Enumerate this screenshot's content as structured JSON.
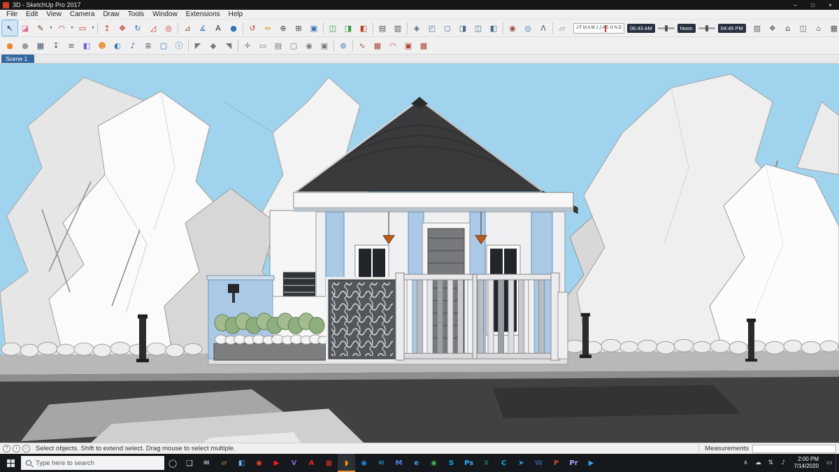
{
  "colors": {
    "titlebar": "#161616",
    "taskbar": "#15181c",
    "scene_tab": "#34689f",
    "selection_blue": "#cfe6f8",
    "sky": "#9fd3ee",
    "accent": "#a9c9e7",
    "roof": "#3a3a3d",
    "road": "#414144",
    "sidewalk": "#b8b8b9"
  },
  "window": {
    "title": "3D - SketchUp Pro 2017",
    "minimize": "–",
    "maximize": "□",
    "close": "×"
  },
  "menu": {
    "items": [
      {
        "name": "menu-file",
        "label": "File"
      },
      {
        "name": "menu-edit",
        "label": "Edit"
      },
      {
        "name": "menu-view",
        "label": "View"
      },
      {
        "name": "menu-camera",
        "label": "Camera"
      },
      {
        "name": "menu-draw",
        "label": "Draw"
      },
      {
        "name": "menu-tools",
        "label": "Tools"
      },
      {
        "name": "menu-window",
        "label": "Window"
      },
      {
        "name": "menu-extensions",
        "label": "Extensions"
      },
      {
        "name": "menu-help",
        "label": "Help"
      }
    ]
  },
  "toolbar_row1": {
    "tools_a": [
      {
        "name": "select-tool-icon",
        "glyph": "↖",
        "color": "#1c1c1c",
        "state": "pressed"
      },
      {
        "name": "eraser-tool-icon",
        "glyph": "◪",
        "color": "#d87093"
      },
      {
        "name": "line-tool-icon",
        "glyph": "✎",
        "color": "#6b4a2b"
      },
      {
        "name": "line-flyout-icon",
        "glyph": "▾",
        "type": "dd"
      },
      {
        "name": "arc-tool-icon",
        "glyph": "◠",
        "color": "#c13b2a"
      },
      {
        "name": "arc-flyout-icon",
        "glyph": "▾",
        "type": "dd"
      },
      {
        "name": "rectangle-tool-icon",
        "glyph": "▭",
        "color": "#c13b2a"
      },
      {
        "name": "shapes-flyout-icon",
        "glyph": "▾",
        "type": "dd"
      },
      {
        "type": "sep",
        "name": "toolbar-separator"
      },
      {
        "name": "push-pull-tool-icon",
        "glyph": "↥",
        "color": "#c13b2a"
      },
      {
        "name": "move-tool-icon",
        "glyph": "✥",
        "color": "#c13b2a"
      },
      {
        "name": "rotate-tool-icon",
        "glyph": "↻",
        "color": "#2e74b5"
      },
      {
        "name": "scale-tool-icon",
        "glyph": "◿",
        "color": "#c13b2a"
      },
      {
        "name": "offset-tool-icon",
        "glyph": "◎",
        "color": "#c13b2a"
      },
      {
        "type": "sep",
        "name": "toolbar-separator"
      },
      {
        "name": "tape-measure-tool-icon",
        "glyph": "⊿",
        "color": "#8a5a2a"
      },
      {
        "name": "protractor-tool-icon",
        "glyph": "∡",
        "color": "#2e74b5"
      },
      {
        "name": "text-tool-icon",
        "glyph": "A",
        "color": "#333333"
      },
      {
        "name": "paint-bucket-tool-icon",
        "glyph": "●",
        "color": "#2e74b5"
      },
      {
        "type": "sep",
        "name": "toolbar-separator"
      },
      {
        "name": "orbit-tool-icon",
        "glyph": "↺",
        "color": "#c13b2a"
      },
      {
        "name": "pan-tool-icon",
        "glyph": "⇔",
        "color": "#d4a017"
      },
      {
        "name": "zoom-tool-icon",
        "glyph": "⊕",
        "color": "#444444"
      },
      {
        "name": "zoom-window-icon",
        "glyph": "⊞",
        "color": "#444444"
      },
      {
        "name": "zoom-extents-icon",
        "glyph": "▣",
        "color": "#2e74b5"
      },
      {
        "type": "sep",
        "name": "toolbar-separator"
      },
      {
        "name": "section-plane-icon",
        "glyph": "◫",
        "color": "#3a9a4a"
      },
      {
        "name": "section-display-icon",
        "glyph": "◨",
        "color": "#3a9a4a"
      },
      {
        "name": "section-cut-icon",
        "glyph": "◧",
        "color": "#c13b2a"
      },
      {
        "type": "sep",
        "name": "toolbar-separator"
      },
      {
        "name": "hide-rest-of-model-icon",
        "glyph": "▤",
        "color": "#555555"
      },
      {
        "name": "back-edges-icon",
        "glyph": "▥",
        "color": "#555555"
      },
      {
        "type": "sep",
        "name": "toolbar-separator"
      },
      {
        "name": "iso-view-icon",
        "glyph": "◈",
        "color": "#4a6f8f"
      },
      {
        "name": "top-view-icon",
        "glyph": "◰",
        "color": "#4a6f8f"
      },
      {
        "name": "front-view-icon",
        "glyph": "◻",
        "color": "#4a6f8f"
      },
      {
        "name": "right-view-icon",
        "glyph": "◨",
        "color": "#4a6f8f"
      },
      {
        "name": "back-view-icon",
        "glyph": "◫",
        "color": "#4a6f8f"
      },
      {
        "name": "left-view-icon",
        "glyph": "◧",
        "color": "#4a6f8f"
      },
      {
        "type": "sep",
        "name": "toolbar-separator"
      },
      {
        "name": "position-camera-icon",
        "glyph": "◉",
        "color": "#a04a4a"
      },
      {
        "name": "look-around-icon",
        "glyph": "◎",
        "color": "#2e74b5"
      },
      {
        "name": "walk-tool-icon",
        "glyph": "Λ",
        "color": "#555555"
      },
      {
        "type": "sep",
        "name": "toolbar-separator"
      },
      {
        "name": "large-eraser-icon",
        "glyph": "▱",
        "color": "#888888"
      }
    ],
    "shadow": {
      "months": "J F M A M J J A S O N D",
      "start": "06:43 AM",
      "mid": "Noon",
      "end": "04:45 PM"
    },
    "tools_b": [
      {
        "name": "materials-panel-icon",
        "glyph": "▨",
        "color": "#666666"
      },
      {
        "name": "components-panel-icon",
        "glyph": "❖",
        "color": "#666666"
      },
      {
        "name": "warehouse-home-icon",
        "glyph": "⌂",
        "color": "#444444"
      },
      {
        "name": "model-box-icon",
        "glyph": "◫",
        "color": "#666666"
      },
      {
        "name": "architecture-icon",
        "glyph": "⌂",
        "color": "#888888"
      },
      {
        "name": "print-icon",
        "glyph": "▦",
        "color": "#555555"
      }
    ]
  },
  "toolbar_row2": {
    "tools": [
      {
        "name": "paint-material-icon",
        "glyph": "●",
        "color": "#e8882a"
      },
      {
        "name": "styles-sphere-icon",
        "glyph": "●",
        "color": "#9a9a9a"
      },
      {
        "name": "printer-icon",
        "glyph": "▦",
        "color": "#44556a"
      },
      {
        "name": "export-icon",
        "glyph": "↧",
        "color": "#555555"
      },
      {
        "name": "layers-stack-icon",
        "glyph": "≡",
        "color": "#555555"
      },
      {
        "name": "component-box-icon",
        "glyph": "◧",
        "color": "#7b5cd6"
      },
      {
        "name": "face-style-icon",
        "glyph": "☻",
        "color": "#e8882a"
      },
      {
        "name": "globe-model-icon",
        "glyph": "◐",
        "color": "#2e74b5"
      },
      {
        "name": "sound-icon",
        "glyph": "♪",
        "color": "#3a6ea5"
      },
      {
        "name": "sliders-icon",
        "glyph": "≣",
        "color": "#555555"
      },
      {
        "name": "chat-bubble-icon",
        "glyph": "▢",
        "color": "#2e74b5"
      },
      {
        "name": "info-circle-icon",
        "glyph": "ⓘ",
        "color": "#2e74b5"
      },
      {
        "type": "sep",
        "name": "toolbar-separator"
      },
      {
        "name": "align-left-icon",
        "glyph": "◤",
        "color": "#777777"
      },
      {
        "name": "align-center-icon",
        "glyph": "◆",
        "color": "#777777"
      },
      {
        "name": "align-right-icon",
        "glyph": "◥",
        "color": "#777777"
      },
      {
        "type": "sep",
        "name": "toolbar-separator"
      },
      {
        "name": "interact-tool-icon",
        "glyph": "✛",
        "color": "#777777"
      },
      {
        "name": "component-options-icon",
        "glyph": "▭",
        "color": "#777777"
      },
      {
        "name": "component-attributes-icon",
        "glyph": "▤",
        "color": "#777777"
      },
      {
        "name": "camera-create-icon",
        "glyph": "▢",
        "color": "#777777"
      },
      {
        "name": "camera-look-icon",
        "glyph": "◉",
        "color": "#777777"
      },
      {
        "name": "camera-settings-icon",
        "glyph": "▣",
        "color": "#777777"
      },
      {
        "type": "sep",
        "name": "toolbar-separator"
      },
      {
        "name": "add-location-globe-icon",
        "glyph": "⊚",
        "color": "#2e74b5"
      },
      {
        "type": "sep",
        "name": "toolbar-separator"
      },
      {
        "name": "sandbox-from-contours-icon",
        "glyph": "∿",
        "color": "#a84432"
      },
      {
        "name": "sandbox-from-scratch-icon",
        "glyph": "▦",
        "color": "#a84432"
      },
      {
        "name": "smoove-tool-icon",
        "glyph": "◠",
        "color": "#a84432"
      },
      {
        "name": "stamp-tool-icon",
        "glyph": "▣",
        "color": "#a84432"
      },
      {
        "name": "drape-tool-icon",
        "glyph": "▩",
        "color": "#a84432"
      }
    ]
  },
  "scene_tabs": {
    "active": "Scene 1"
  },
  "statusbar": {
    "icons": [
      {
        "name": "geolocation-status-icon",
        "glyph": "?"
      },
      {
        "name": "credits-status-icon",
        "glyph": "i"
      },
      {
        "name": "help-status-icon",
        "glyph": "☺"
      }
    ],
    "hint": "Select objects. Shift to extend select. Drag mouse to select multiple.",
    "measurements_label": "Measurements",
    "measurements_value": ""
  },
  "taskbar": {
    "search": {
      "placeholder": "Type here to search"
    },
    "cortana_glyph": "◯",
    "taskview_glyph": "❏",
    "apps": [
      {
        "name": "mail-icon",
        "glyph": "✉",
        "color": "#e3e6ea"
      },
      {
        "name": "file-explorer-icon",
        "glyph": "▱",
        "color": "#f6c65a"
      },
      {
        "name": "photos-icon",
        "glyph": "◧",
        "color": "#64b5f6"
      },
      {
        "name": "opera-icon",
        "glyph": "◉",
        "color": "#ea4335"
      },
      {
        "name": "youtube-icon",
        "glyph": "▶",
        "color": "#ff1a1a"
      },
      {
        "name": "viber-icon",
        "glyph": "V",
        "color": "#8e61d6"
      },
      {
        "name": "adobe-reader-icon",
        "glyph": "A",
        "color": "#e2231a"
      },
      {
        "name": "red-tiles-app-icon",
        "glyph": "▦",
        "color": "#d93025"
      },
      {
        "name": "firefox-icon",
        "glyph": "◗",
        "color": "#ff9400",
        "active": true
      },
      {
        "name": "compass-browser-icon",
        "glyph": "◉",
        "color": "#1b88e5"
      },
      {
        "name": "thunderbird-icon",
        "glyph": "✉",
        "color": "#2aa1da"
      },
      {
        "name": "gmail-icon",
        "glyph": "M",
        "color": "#5086ec"
      },
      {
        "name": "edge-icon",
        "glyph": "e",
        "color": "#35a2e5"
      },
      {
        "name": "chrome-icon",
        "glyph": "◉",
        "color": "#4caf50"
      },
      {
        "name": "skype-icon",
        "glyph": "S",
        "color": "#00aff0"
      },
      {
        "name": "photoshop-icon",
        "glyph": "Ps",
        "color": "#31a8ff"
      },
      {
        "name": "excel-icon",
        "glyph": "X",
        "color": "#1d6f42"
      },
      {
        "name": "teal-c-app-icon",
        "glyph": "C",
        "color": "#00bcd4"
      },
      {
        "name": "telegram-icon",
        "glyph": "➤",
        "color": "#2aa3da"
      },
      {
        "name": "word-icon",
        "glyph": "W",
        "color": "#2b579a"
      },
      {
        "name": "powerpoint-icon",
        "glyph": "P",
        "color": "#d24726"
      },
      {
        "name": "premiere-icon",
        "glyph": "Pr",
        "color": "#b9a0ff"
      },
      {
        "name": "movies-app-icon",
        "glyph": "▶",
        "color": "#3aa0e8"
      }
    ],
    "tray": {
      "icons": [
        {
          "name": "tray-chevron-icon",
          "glyph": "∧"
        },
        {
          "name": "onedrive-icon",
          "glyph": "☁"
        },
        {
          "name": "network-icon",
          "glyph": "⇅"
        },
        {
          "name": "volume-icon",
          "glyph": "♪"
        }
      ],
      "time": "2:00 PM",
      "date": "7/14/2020",
      "action_glyph": "▭"
    }
  }
}
